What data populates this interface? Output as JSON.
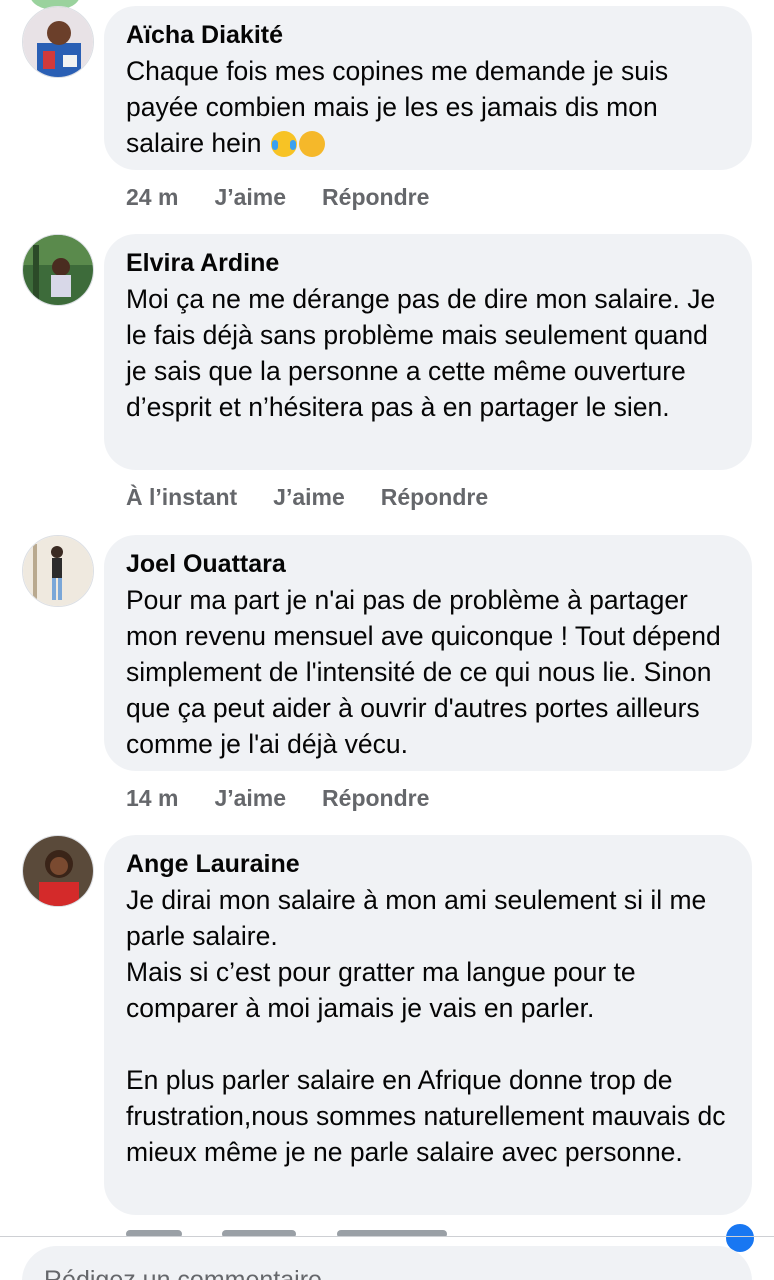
{
  "comments": [
    {
      "author": "Aïcha Diakité",
      "text": "Chaque fois mes copines me demande je suis payée combien mais je les es jamais dis mon salaire hein",
      "emoji": [
        "face-with-tears-of-joy-emoji",
        "persevering-face-emoji"
      ],
      "time": "24 m",
      "like": "J’aime",
      "reply": "Répondre"
    },
    {
      "author": "Elvira Ardine",
      "text": "Moi ça ne me dérange pas de dire mon salaire. Je le fais déjà sans problème mais seulement quand je sais que la personne a cette même ouverture d’esprit et n’hésitera pas à en partager le sien.",
      "time": "À l’instant",
      "like": "J’aime",
      "reply": "Répondre"
    },
    {
      "author": "Joel Ouattara",
      "text": "Pour ma part je n'ai pas de problème à partager mon revenu mensuel ave quiconque ! Tout dépend simplement de l'intensité de ce qui nous lie. Sinon que ça peut aider à ouvrir d'autres portes ailleurs comme je l'ai déjà vécu.",
      "time": "14 m",
      "like": "J’aime",
      "reply": "Répondre"
    },
    {
      "author": "Ange Lauraine",
      "text": "Je dirai mon salaire à mon ami seulement si il me parle salaire.\nMais si c’est pour gratter ma langue pour te comparer à moi jamais je vais en parler.\n\nEn plus parler salaire en Afrique donne trop de frustration,nous sommes naturellement mauvais dc mieux même je ne parle salaire avec personne."
    }
  ],
  "composer": {
    "placeholder": "Rédigez un commentaire"
  },
  "colors": {
    "bubble": "#f0f2f5",
    "meta": "#65676b",
    "accent": "#1877f2"
  }
}
